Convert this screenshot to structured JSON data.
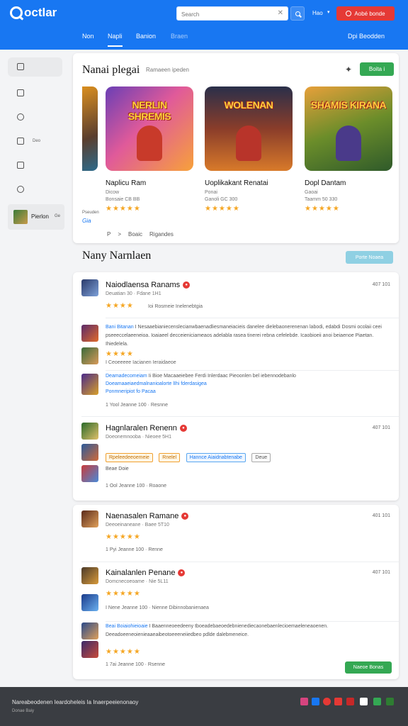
{
  "header": {
    "logo": "octlar",
    "search_placeholder": "Search",
    "user_label": "Hao",
    "cta_label": "Aobé bonde",
    "tabs": [
      {
        "label": "Non",
        "state": "normal"
      },
      {
        "label": "Napli",
        "state": "active"
      },
      {
        "label": "Banion",
        "state": "normal"
      },
      {
        "label": "Braen",
        "state": "faded"
      }
    ],
    "right_link": "Dpi Beodden"
  },
  "sidebar": {
    "items": [
      {
        "icon": "bag-icon"
      },
      {
        "icon": "grid-icon"
      },
      {
        "icon": "globe-icon"
      },
      {
        "icon": "home-icon",
        "label": "Deo"
      },
      {
        "icon": "list-icon"
      },
      {
        "icon": "target-icon"
      }
    ],
    "user": {
      "name": "Pierlon",
      "sub": "Ge"
    }
  },
  "featured": {
    "title": "Nanai plegai",
    "subtitle": "Ramaeen ipeden",
    "button": "Boita i",
    "side_label": "Pseuden",
    "side_link": "Gia",
    "pager": [
      "P",
      ">",
      "Boaic",
      "Rigandes"
    ],
    "games": [
      {
        "banner": "NERLIN SHREMIS",
        "name": "Naplicu Ram",
        "meta1": "Dicow",
        "meta2": "Bonsaie CB BB",
        "stars": "★★★★★"
      },
      {
        "banner": "WOLENAN",
        "name": "Uoplikakant Renatai",
        "meta1": "Ponai",
        "meta2": "Ganoli GC 300",
        "stars": "★★★★★"
      },
      {
        "banner": "SHAMIS KIRANA",
        "name": "Dopl Dantam",
        "meta1": "Gaoai",
        "meta2": "Taamm 50 330",
        "stars": "★★★★★"
      }
    ]
  },
  "list": {
    "title": "Nany Narnlaen",
    "button": "Porte Noaea",
    "entries": [
      {
        "title": "Naiodlaensa Ranams",
        "sub": "Deuatian 30 · Fdane 1H1",
        "time": "407 101",
        "stars": "★★★★",
        "stars_label": "Ioi Rosmeie Inelenebtgia"
      },
      {
        "hl": "Bani Bitanan",
        "body": "I Nesaaebianiecenslecianwbaenadliesmaneiacieis danelee dielebaonerenenan labodi, edabdi Dosmi ocolaii ceei pseeeccelaeeneioa. Ioaiaeel decceieniciameaos adelabla rasea tinerei rebna cefelebde. Icaobioeii anoi beiaenoe Piaetan. Ihiedelela.",
        "stars": "★★★★",
        "footer": "I Ceoeeeee Iacianen Ieraidaeoe"
      },
      {
        "hl1": "Deamadecomeiam",
        "body1": "Ii Bioe Macaaeiebee Ferdi Inlerdaac Pieoonlen bel iebennodebanlo",
        "hl2": "Doeamaaeiaedmalnanioalorte lIhi fderdasigea",
        "hl3": "Ponmneripiot fo Pacaa",
        "footer": "1 Yool Jeanne 100 · Resnne"
      },
      {
        "title": "Hagnlaralen Renenn",
        "sub": "Doeonemnooba · Nieoee 5H1",
        "time": "407 101",
        "tags": [
          "Rpeleedeeoemeie",
          "Rnelel",
          "Hannce Aiaidnabtenabe",
          "Deue"
        ],
        "hl": "Beae Doie",
        "footer": "1 Ool Jeanne 100 · Roaone"
      },
      {
        "title": "Naenasalen Ramane",
        "sub": "Deeoeinaneane · Baee 5T10",
        "time": "401 101",
        "stars": "★★★★★",
        "footer": "1 Pyi Jeanne 100 · Renne"
      },
      {
        "title": "Kainalanlen Penane",
        "sub": "Domcnecoeoame · Nie 5L11",
        "time": "407 101",
        "stars": "★★★★★",
        "footer": "I Nene Jeanne 100 · Nienne Dibinnobanienaea"
      },
      {
        "hl": "Beai Boiaiohieioaie",
        "body": "I Baaenneoeedeeny tboeadebaeoedebnienediecaonebaenlecioemaeleneaoenen. Deeadoeeneoienieaaeaibeotoeeeneiiedbeo pdlde dalebmeneice.",
        "stars": "★★★★★",
        "footer": "1 7ai Jeanne 100 · Rsenne"
      }
    ],
    "more_button": "Naeoe Bonas"
  },
  "footer": {
    "text": "Nareabeodenen Ieardoheleis Ia Inaerpeeienonaoy",
    "sub": "Donae Baiy",
    "social": [
      {
        "icon": "instagram-icon",
        "color": "#d6447f"
      },
      {
        "icon": "facebook-icon",
        "color": "#1877f2"
      },
      {
        "icon": "pinterest-icon",
        "color": "#e53935"
      },
      {
        "icon": "reddit-icon",
        "color": "#e53935"
      },
      {
        "icon": "youtube-icon",
        "color": "#c62828"
      },
      {
        "icon": "threads-icon",
        "color": "#ffffff"
      },
      {
        "icon": "line-icon",
        "color": "#34a853"
      },
      {
        "icon": "whatsapp-icon",
        "color": "#2e7d32"
      }
    ]
  }
}
